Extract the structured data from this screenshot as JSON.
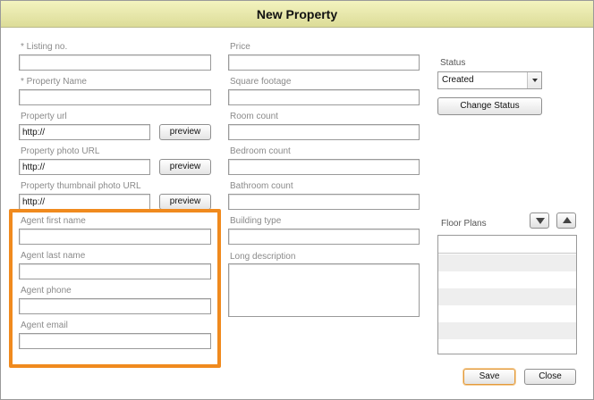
{
  "dialog": {
    "title": "New Property"
  },
  "left_fields": {
    "listing_no": {
      "label": "* Listing no.",
      "value": ""
    },
    "property_name": {
      "label": "* Property Name",
      "value": ""
    },
    "property_url": {
      "label": "Property url",
      "value": "http://"
    },
    "photo_url": {
      "label": "Property photo URL",
      "value": "http://"
    },
    "thumbnail_url": {
      "label": "Property thumbnail photo URL",
      "value": "http://"
    },
    "preview_label": "preview"
  },
  "agent_fields": {
    "first_name": {
      "label": "Agent first name",
      "value": ""
    },
    "last_name": {
      "label": "Agent last name",
      "value": ""
    },
    "phone": {
      "label": "Agent phone",
      "value": ""
    },
    "email": {
      "label": "Agent email",
      "value": ""
    }
  },
  "middle_fields": {
    "price": {
      "label": "Price",
      "value": ""
    },
    "square_footage": {
      "label": "Square footage",
      "value": ""
    },
    "room_count": {
      "label": "Room count",
      "value": ""
    },
    "bedroom_count": {
      "label": "Bedroom count",
      "value": ""
    },
    "bathroom_count": {
      "label": "Bathroom count",
      "value": ""
    },
    "building_type": {
      "label": "Building type",
      "value": ""
    },
    "long_description": {
      "label": "Long description",
      "value": ""
    }
  },
  "status": {
    "label": "Status",
    "selected": "Created",
    "change_label": "Change Status"
  },
  "floor_plans": {
    "label": "Floor Plans",
    "rows": 6
  },
  "footer": {
    "save_label": "Save",
    "close_label": "Close"
  },
  "colors": {
    "highlight": "#f08a1e",
    "title_bg": "#dcdc98"
  },
  "icons": {
    "down": "arrow-down-icon",
    "up": "arrow-up-icon",
    "dropdown": "chevron-down-icon"
  }
}
